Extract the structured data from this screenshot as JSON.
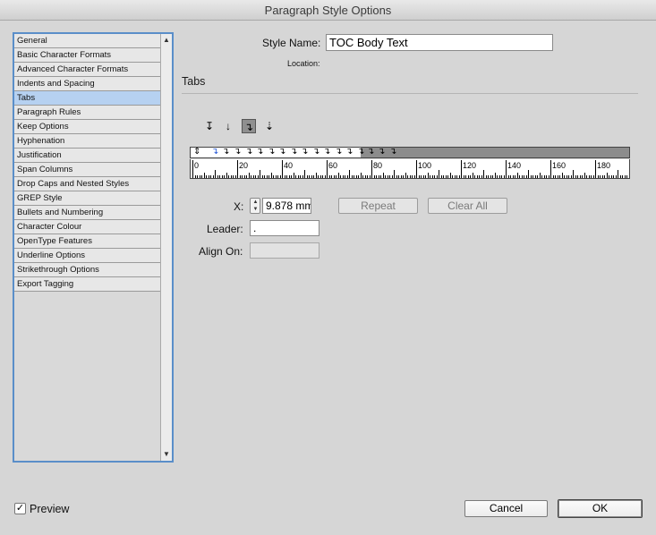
{
  "window": {
    "title": "Paragraph Style Options"
  },
  "sidebar": {
    "items": [
      {
        "label": "General",
        "selected": false
      },
      {
        "label": "Basic Character Formats",
        "selected": false
      },
      {
        "label": "Advanced Character Formats",
        "selected": false
      },
      {
        "label": "Indents and Spacing",
        "selected": false
      },
      {
        "label": "Tabs",
        "selected": true
      },
      {
        "label": "Paragraph Rules",
        "selected": false
      },
      {
        "label": "Keep Options",
        "selected": false
      },
      {
        "label": "Hyphenation",
        "selected": false
      },
      {
        "label": "Justification",
        "selected": false
      },
      {
        "label": "Span Columns",
        "selected": false
      },
      {
        "label": "Drop Caps and Nested Styles",
        "selected": false
      },
      {
        "label": "GREP Style",
        "selected": false
      },
      {
        "label": "Bullets and Numbering",
        "selected": false
      },
      {
        "label": "Character Colour",
        "selected": false
      },
      {
        "label": "OpenType Features",
        "selected": false
      },
      {
        "label": "Underline Options",
        "selected": false
      },
      {
        "label": "Strikethrough Options",
        "selected": false
      },
      {
        "label": "Export Tagging",
        "selected": false
      }
    ]
  },
  "style_name": {
    "label": "Style Name:",
    "value": "TOC Body Text"
  },
  "location": {
    "label": "Location:"
  },
  "section": {
    "title": "Tabs"
  },
  "tab_types": [
    {
      "icon": "left-justified-tab-icon",
      "glyph": "↧",
      "active": false
    },
    {
      "icon": "center-justified-tab-icon",
      "glyph": "↓",
      "active": false
    },
    {
      "icon": "right-justified-tab-icon",
      "glyph": "↴",
      "active": true
    },
    {
      "icon": "align-to-decimal-tab-icon",
      "glyph": "⇣",
      "active": false
    }
  ],
  "ruler": {
    "labels": [
      "0",
      "20",
      "40",
      "60",
      "80",
      "100",
      "120",
      "140",
      "160",
      "180"
    ]
  },
  "x_field": {
    "label": "X:",
    "value": "9.878 mm"
  },
  "leader_field": {
    "label": "Leader:",
    "value": "."
  },
  "align_on_field": {
    "label": "Align On:",
    "value": ""
  },
  "buttons": {
    "repeat": "Repeat",
    "clear_all": "Clear All",
    "cancel": "Cancel",
    "ok": "OK"
  },
  "preview": {
    "label": "Preview",
    "checked": true,
    "check_glyph": "✓"
  },
  "colors": {
    "accent": "#5a8ec9",
    "selection": "#b6d1f1"
  }
}
